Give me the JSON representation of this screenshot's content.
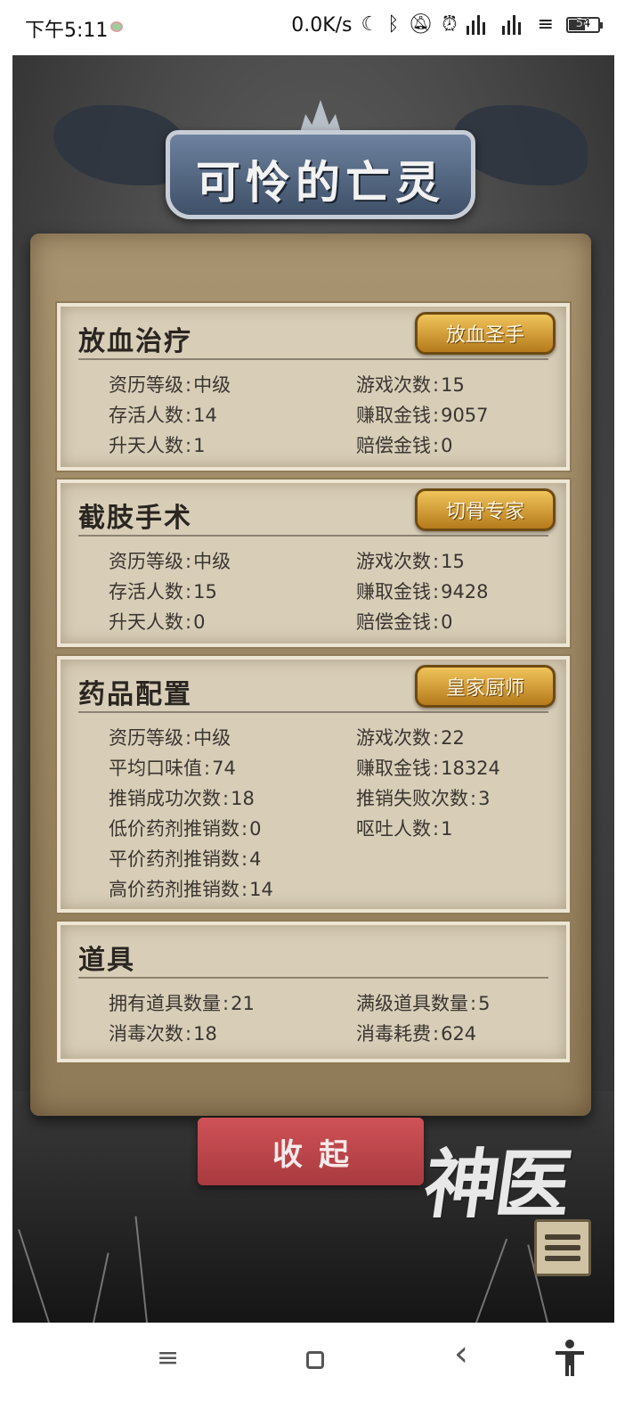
{
  "status_bar": {
    "time": "下午5:11",
    "net_speed": "0.0K/s",
    "battery": "54",
    "icons": [
      "moon-icon",
      "bluetooth-icon",
      "mute-bell-icon",
      "alarm-icon",
      "signal-icon",
      "signal-icon",
      "wifi-icon",
      "battery-icon"
    ]
  },
  "banner": {
    "title": "可怜的亡灵"
  },
  "sections": [
    {
      "title": "放血治疗",
      "badge": "放血圣手",
      "stats": [
        {
          "label": "资历等级",
          "value": "中级"
        },
        {
          "label": "游戏次数",
          "value": "15"
        },
        {
          "label": "存活人数",
          "value": "14"
        },
        {
          "label": "赚取金钱",
          "value": "9057"
        },
        {
          "label": "升天人数",
          "value": "1"
        },
        {
          "label": "赔偿金钱",
          "value": "0"
        }
      ]
    },
    {
      "title": "截肢手术",
      "badge": "切骨专家",
      "stats": [
        {
          "label": "资历等级",
          "value": "中级"
        },
        {
          "label": "游戏次数",
          "value": "15"
        },
        {
          "label": "存活人数",
          "value": "15"
        },
        {
          "label": "赚取金钱",
          "value": "9428"
        },
        {
          "label": "升天人数",
          "value": "0"
        },
        {
          "label": "赔偿金钱",
          "value": "0"
        }
      ]
    },
    {
      "title": "药品配置",
      "badge": "皇家厨师",
      "stats": [
        {
          "label": "资历等级",
          "value": "中级"
        },
        {
          "label": "游戏次数",
          "value": "22"
        },
        {
          "label": "平均口味值",
          "value": "74"
        },
        {
          "label": "赚取金钱",
          "value": "18324"
        },
        {
          "label": "推销成功次数",
          "value": "18"
        },
        {
          "label": "推销失败次数",
          "value": "3"
        },
        {
          "label": "低价药剂推销数",
          "value": "0"
        },
        {
          "label": "呕吐人数",
          "value": "1"
        },
        {
          "label": "平价药剂推销数",
          "value": "4"
        },
        {
          "label": "高价药剂推销数",
          "value": "14"
        }
      ]
    },
    {
      "title": "道具",
      "stats": [
        {
          "label": "拥有道具数量",
          "value": "21"
        },
        {
          "label": "满级道具数量",
          "value": "5"
        },
        {
          "label": "消毒次数",
          "value": "18"
        },
        {
          "label": "消毒耗费",
          "value": "624"
        }
      ]
    }
  ],
  "sep": ":",
  "collapse_button": "收起",
  "logo": "神医",
  "nav": {
    "menu": "≡",
    "back": "‹"
  }
}
